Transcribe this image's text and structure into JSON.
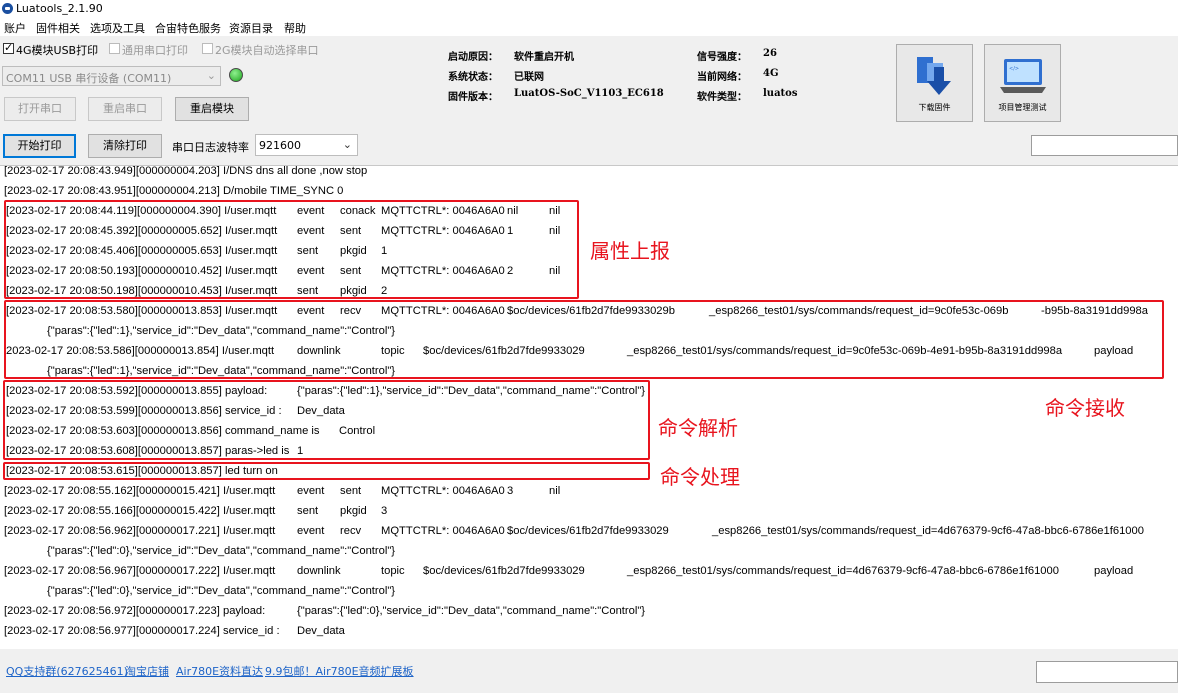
{
  "window": {
    "title": "Luatools_2.1.90"
  },
  "menu": [
    "账户",
    "固件相关",
    "选项及工具",
    "合宙特色服务",
    "资源目录",
    "帮助"
  ],
  "options": {
    "usb4g": {
      "label": "4G模块USB打印",
      "checked": true
    },
    "generic_serial": {
      "label": "通用串口打印",
      "checked": false
    },
    "auto_2g": {
      "label": "2G模块自动选择串口",
      "checked": false
    }
  },
  "port_select": {
    "value": "COM11 USB 串行设备 (COM11)"
  },
  "buttons": {
    "open_port": "打开串口",
    "restart_port": "重启串口",
    "restart_module": "重启模块",
    "start_print": "开始打印",
    "clear_print": "清除打印",
    "download_fw": "下载固件",
    "project_test": "项目管理测试"
  },
  "baud": {
    "label": "串口日志波特率",
    "value": "921600"
  },
  "info": {
    "boot_reason_label": "启动原因：",
    "boot_reason": "软件重启开机",
    "sys_status_label": "系统状态：",
    "sys_status": "已联网",
    "fw_version_label": "固件版本：",
    "fw_version": "LuatOS-SoC_V1103_EC618",
    "signal_label": "信号强度：",
    "signal": "26",
    "network_label": "当前网络：",
    "network": "4G",
    "software_type_label": "软件类型：",
    "software_type": "luatos"
  },
  "log_rows": [
    [
      "[2023-02-17 20:08:43.949][000000004.203] I/DNS dns all done ,now stop"
    ],
    [
      "[2023-02-17 20:08:43.951][000000004.213] D/mobile TIME_SYNC 0"
    ],
    [
      "[2023-02-17 20:08:44.119][000000004.390] I/user.mqtt",
      "event",
      "conack",
      "MQTTCTRL*: 0046A6A0",
      "nil",
      "nil"
    ],
    [
      "[2023-02-17 20:08:45.392][000000005.652] I/user.mqtt",
      "event",
      "sent",
      "MQTTCTRL*: 0046A6A0",
      "1",
      "nil"
    ],
    [
      "[2023-02-17 20:08:45.406][000000005.653] I/user.mqtt",
      "sent",
      "pkgid",
      "1"
    ],
    [
      "[2023-02-17 20:08:50.193][000000010.452] I/user.mqtt",
      "event",
      "sent",
      "MQTTCTRL*: 0046A6A0",
      "2",
      "nil"
    ],
    [
      "[2023-02-17 20:08:50.198][000000010.453] I/user.mqtt",
      "sent",
      "pkgid",
      "2"
    ],
    [
      "[2023-02-17 20:08:53.580][000000013.853] I/user.mqtt",
      "event",
      "recv",
      "MQTTCTRL*: 0046A6A0",
      "$oc/devices/61fb2d7fde9933029b",
      "_esp8266_test01/sys/commands/request_id=9c0fe53c-069b",
      "-b95b-8a3191dd998a"
    ],
    [
      "{\"paras\":{\"led\":1},\"service_id\":\"Dev_data\",\"command_name\":\"Control\"}"
    ],
    [
      "2023-02-17 20:08:53.586][000000013.854] I/user.mqtt",
      "downlink",
      "topic",
      "$oc/devices/61fb2d7fde9933029",
      "_esp8266_test01/sys/commands/request_id=9c0fe53c-069b-4e91-b95b-8a3191dd998a",
      "payload"
    ],
    [
      "{\"paras\":{\"led\":1},\"service_id\":\"Dev_data\",\"command_name\":\"Control\"}"
    ],
    [
      "[2023-02-17 20:08:53.592][000000013.855] payload:",
      "{\"paras\":{\"led\":1},\"service_id\":\"Dev_data\",\"command_name\":\"Control\"}"
    ],
    [
      "[2023-02-17 20:08:53.599][000000013.856] service_id :",
      "Dev_data"
    ],
    [
      "[2023-02-17 20:08:53.603][000000013.856] command_name is",
      "Control"
    ],
    [
      "[2023-02-17 20:08:53.608][000000013.857] paras->led is",
      "1"
    ],
    [
      "[2023-02-17 20:08:53.615][000000013.857] led turn on"
    ],
    [
      "[2023-02-17 20:08:55.162][000000015.421] I/user.mqtt",
      "event",
      "sent",
      "MQTTCTRL*: 0046A6A0",
      "3",
      "nil"
    ],
    [
      "[2023-02-17 20:08:55.166][000000015.422] I/user.mqtt",
      "sent",
      "pkgid",
      "3"
    ],
    [
      "[2023-02-17 20:08:56.962][000000017.221] I/user.mqtt",
      "event",
      "recv",
      "MQTTCTRL*: 0046A6A0",
      "$oc/devices/61fb2d7fde9933029",
      "_esp8266_test01/sys/commands/request_id=4d676379-9cf6-47a8-bbc6-6786e1f61000"
    ],
    [
      "{\"paras\":{\"led\":0},\"service_id\":\"Dev_data\",\"command_name\":\"Control\"}"
    ],
    [
      "[2023-02-17 20:08:56.967][000000017.222] I/user.mqtt",
      "downlink",
      "topic",
      "$oc/devices/61fb2d7fde9933029",
      "_esp8266_test01/sys/commands/request_id=4d676379-9cf6-47a8-bbc6-6786e1f61000",
      "payload"
    ],
    [
      "{\"paras\":{\"led\":0},\"service_id\":\"Dev_data\",\"command_name\":\"Control\"}"
    ],
    [
      "[2023-02-17 20:08:56.972][000000017.223] payload:",
      "{\"paras\":{\"led\":0},\"service_id\":\"Dev_data\",\"command_name\":\"Control\"}"
    ],
    [
      "[2023-02-17 20:08:56.977][000000017.224] service_id :",
      "Dev_data"
    ]
  ],
  "annotations": {
    "property_report": "属性上报",
    "command_receive": "命令接收",
    "command_parse": "命令解析",
    "command_process": "命令处理"
  },
  "footer": {
    "links": [
      "QQ支持群(627625461)",
      "淘宝店铺",
      "Air780E资料直达",
      "9.9包邮！Air780E音频扩展板"
    ]
  }
}
